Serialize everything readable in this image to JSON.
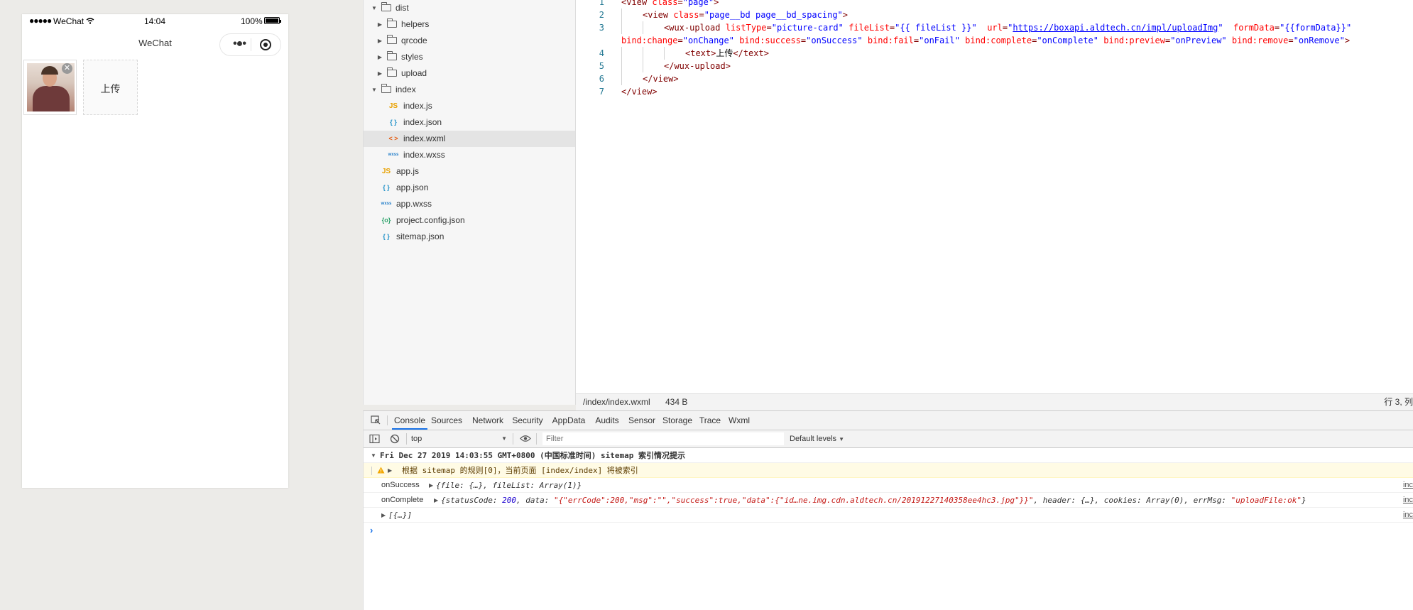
{
  "simulator": {
    "status_bar": {
      "signal": "●●●●●",
      "carrier": "WeChat",
      "time": "14:04",
      "battery_pct": "100%"
    },
    "nav_title": "WeChat",
    "capsule_more": "•●•",
    "upload_button_label": "上传",
    "remove_glyph": "✕"
  },
  "file_tree": [
    {
      "label": "dist",
      "kind": "folder",
      "expanded": true,
      "depth": 0
    },
    {
      "label": "helpers",
      "kind": "folder",
      "expanded": false,
      "depth": 1
    },
    {
      "label": "qrcode",
      "kind": "folder",
      "expanded": false,
      "depth": 1
    },
    {
      "label": "styles",
      "kind": "folder",
      "expanded": false,
      "depth": 1
    },
    {
      "label": "upload",
      "kind": "folder",
      "expanded": false,
      "depth": 1
    },
    {
      "label": "index",
      "kind": "folder",
      "expanded": true,
      "depth": 0
    },
    {
      "label": "index.js",
      "kind": "js",
      "icon": "JS",
      "depth": 1
    },
    {
      "label": "index.json",
      "kind": "json",
      "icon": "{ }",
      "depth": 1
    },
    {
      "label": "index.wxml",
      "kind": "wxml",
      "icon": "< >",
      "depth": 1,
      "selected": true
    },
    {
      "label": "index.wxss",
      "kind": "wxss",
      "icon": "wxss",
      "depth": 1
    },
    {
      "label": "app.js",
      "kind": "js",
      "icon": "JS",
      "depth": 0
    },
    {
      "label": "app.json",
      "kind": "json",
      "icon": "{ }",
      "depth": 0
    },
    {
      "label": "app.wxss",
      "kind": "wxss",
      "icon": "wxss",
      "depth": 0
    },
    {
      "label": "project.config.json",
      "kind": "config",
      "icon": "{o}",
      "depth": 0
    },
    {
      "label": "sitemap.json",
      "kind": "json",
      "icon": "{ }",
      "depth": 0
    }
  ],
  "editor": {
    "lines": [
      {
        "n": "1",
        "indent": 0,
        "tokens": [
          [
            "tag",
            "<view "
          ],
          [
            "attr",
            "class"
          ],
          [
            "tag",
            "="
          ],
          [
            "val",
            "\"page\""
          ],
          [
            "tag",
            ">"
          ]
        ]
      },
      {
        "n": "2",
        "indent": 1,
        "tokens": [
          [
            "tag",
            "<view "
          ],
          [
            "attr",
            "class"
          ],
          [
            "tag",
            "="
          ],
          [
            "val",
            "\"page__bd page__bd_spacing\""
          ],
          [
            "tag",
            ">"
          ]
        ]
      },
      {
        "n": "3",
        "indent": 2,
        "tokens": [
          [
            "tag",
            "<wux-upload "
          ],
          [
            "attr",
            "listType"
          ],
          [
            "tag",
            "="
          ],
          [
            "val",
            "\"picture-card\""
          ],
          [
            "text",
            " "
          ],
          [
            "attr",
            "fileList"
          ],
          [
            "tag",
            "="
          ],
          [
            "val",
            "\"{{ fileList }}\""
          ],
          [
            "text",
            "  "
          ],
          [
            "attr",
            "url"
          ],
          [
            "tag",
            "="
          ],
          [
            "val",
            "\""
          ],
          [
            "url",
            "https://boxapi.aldtech.cn/impl/uploadImg"
          ],
          [
            "val",
            "\""
          ],
          [
            "text",
            "  "
          ],
          [
            "attr",
            "formData"
          ],
          [
            "tag",
            "="
          ],
          [
            "val",
            "\"{{formData}}\""
          ]
        ]
      },
      {
        "n": "",
        "indent": 0,
        "tokens": [
          [
            "attr",
            "bind:change"
          ],
          [
            "tag",
            "="
          ],
          [
            "val",
            "\"onChange\""
          ],
          [
            "text",
            " "
          ],
          [
            "attr",
            "bind:success"
          ],
          [
            "tag",
            "="
          ],
          [
            "val",
            "\"onSuccess\""
          ],
          [
            "text",
            " "
          ],
          [
            "attr",
            "bind:fail"
          ],
          [
            "tag",
            "="
          ],
          [
            "val",
            "\"onFail\""
          ],
          [
            "text",
            " "
          ],
          [
            "attr",
            "bind:complete"
          ],
          [
            "tag",
            "="
          ],
          [
            "val",
            "\"onComplete\""
          ],
          [
            "text",
            " "
          ],
          [
            "attr",
            "bind:preview"
          ],
          [
            "tag",
            "="
          ],
          [
            "val",
            "\"onPreview\""
          ],
          [
            "text",
            " "
          ],
          [
            "attr",
            "bind:remove"
          ],
          [
            "tag",
            "="
          ],
          [
            "val",
            "\"onRemove\""
          ],
          [
            "tag",
            ">"
          ]
        ]
      },
      {
        "n": "4",
        "indent": 3,
        "tokens": [
          [
            "tag",
            "<text>"
          ],
          [
            "text",
            "上传"
          ],
          [
            "tag",
            "</text>"
          ]
        ]
      },
      {
        "n": "5",
        "indent": 2,
        "tokens": [
          [
            "tag",
            "</wux-upload>"
          ]
        ]
      },
      {
        "n": "6",
        "indent": 1,
        "tokens": [
          [
            "tag",
            "</view>"
          ]
        ]
      },
      {
        "n": "7",
        "indent": 0,
        "tokens": [
          [
            "tag",
            "</view>"
          ]
        ]
      }
    ],
    "status": {
      "path": "/index/index.wxml",
      "size": "434 B",
      "position": "行 3, 列"
    }
  },
  "devtools": {
    "tabs": [
      "Console",
      "Sources",
      "Network",
      "Security",
      "AppData",
      "Audits",
      "Sensor",
      "Storage",
      "Trace",
      "Wxml"
    ],
    "active_tab": "Console",
    "context": "top",
    "filter_placeholder": "Filter",
    "levels": "Default levels",
    "log": {
      "group_header": "Fri Dec 27 2019 14:03:55 GMT+0800 (中国标准时间) sitemap 索引情况提示",
      "warning": "根据 sitemap 的规则[0]，当前页面 [index/index] 将被索引",
      "success_label": "onSuccess",
      "success_obj": "{file: {…}, fileList: Array(1)}",
      "complete_label": "onComplete",
      "complete_open": "{statusCode: ",
      "complete_status": "200",
      "complete_data_key": ", data: ",
      "complete_data": "\"{\"errCode\":200,\"msg\":\"\",\"success\":true,\"data\":{\"id…ne.img.cdn.aldtech.cn/20191227140358ee4hc3.jpg\"}}\"",
      "complete_rest": ", header: {…}, cookies: Array(0), errMsg: ",
      "complete_errmsg": "\"uploadFile:ok\"",
      "complete_close": "}",
      "array_row": "[{…}]",
      "source": "inc",
      "prompt": "›"
    }
  }
}
